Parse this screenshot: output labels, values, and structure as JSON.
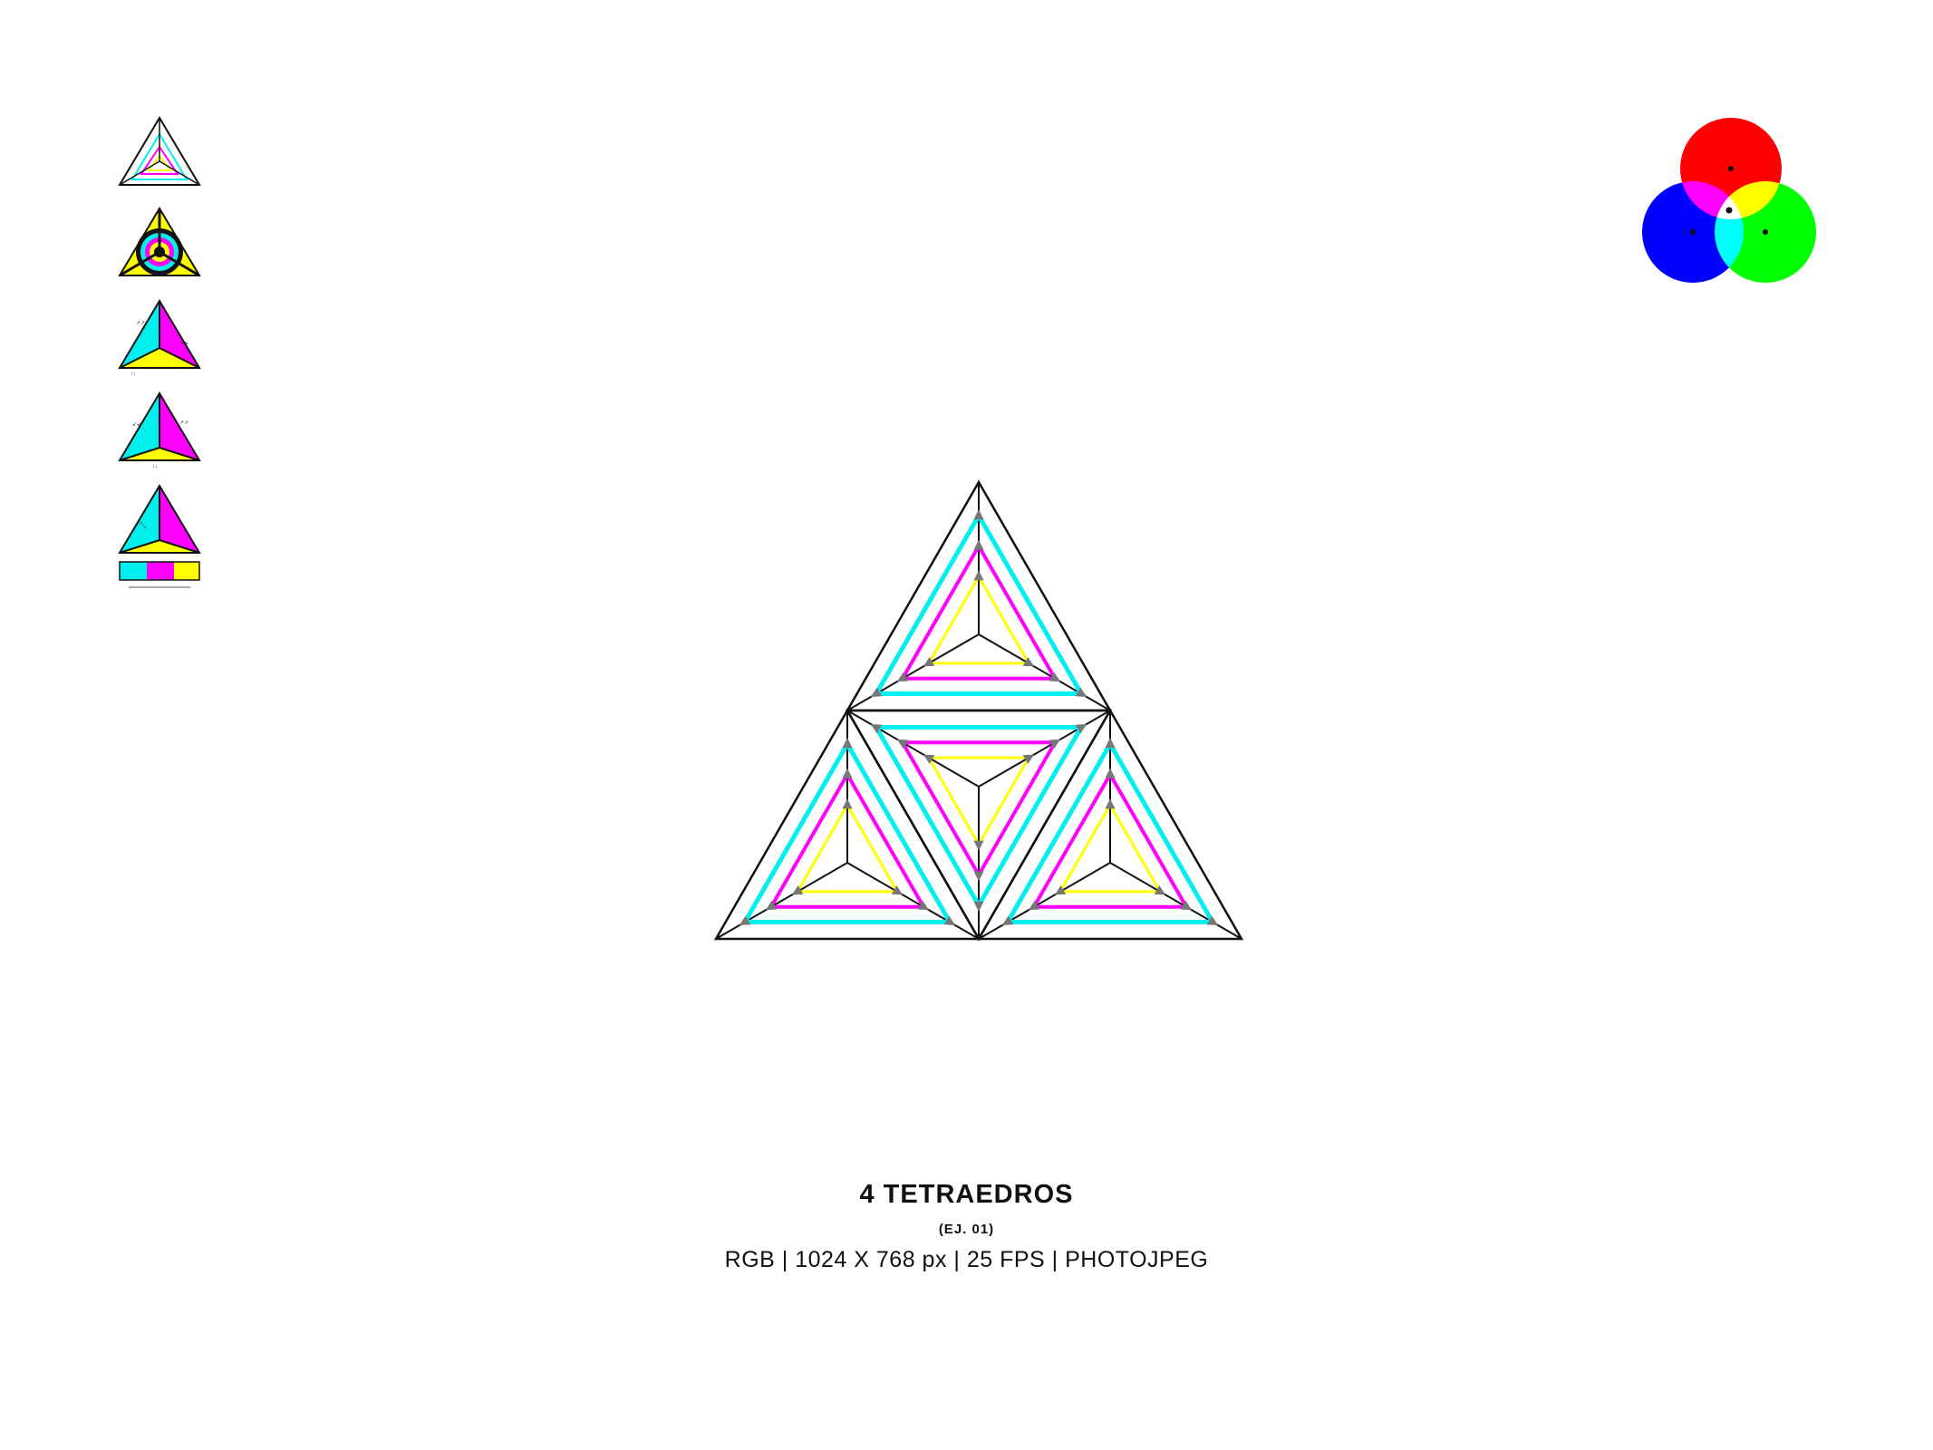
{
  "caption": {
    "title": "4 TETRAEDROS",
    "subtitle": "(EJ. 01)",
    "specs": "RGB | 1024 X 768 px | 25 FPS | PHOTOJPEG"
  },
  "colors": {
    "cyan": "#00f0f0",
    "magenta": "#ff00ff",
    "yellow": "#ffff00",
    "red": "#ff0000",
    "green": "#00ff00",
    "blue": "#0000ff",
    "stroke": "#111111",
    "marker": "#777777"
  },
  "thumbnails": [
    {
      "name": "nested-outline-thumbnail"
    },
    {
      "name": "concentric-rings-thumbnail"
    },
    {
      "name": "cmy-faces-thumbnail"
    },
    {
      "name": "cmy-faces-arrows-thumbnail"
    },
    {
      "name": "cmy-faces-with-strip-thumbnail"
    }
  ],
  "rgb_venn": [
    "red",
    "blue",
    "green"
  ],
  "diagram": {
    "subdivisions": 4,
    "center_inverted": true
  }
}
